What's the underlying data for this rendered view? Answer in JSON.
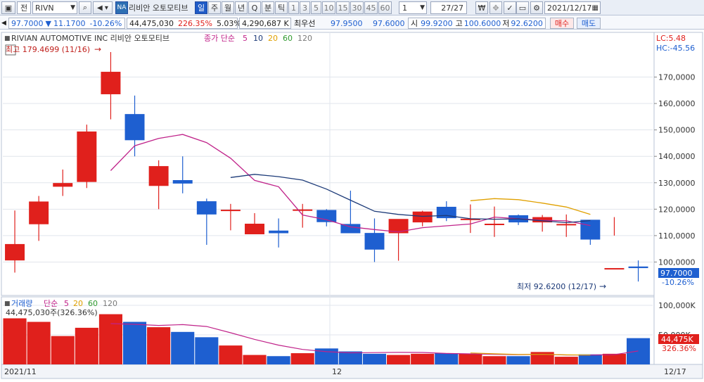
{
  "toolbar": {
    "market_label": "전",
    "symbol": "RIVN",
    "na_badge": "NA",
    "stock_name": "리비안 오토모티브",
    "period_buttons": [
      "일",
      "주",
      "월",
      "년",
      "Q",
      "분",
      "틱"
    ],
    "active_period": "일",
    "interval_buttons": [
      "1",
      "3",
      "5",
      "10",
      "15",
      "30",
      "45",
      "60"
    ],
    "count_value": "1",
    "page_counter": "27/27",
    "date": "2021/12/17"
  },
  "quote": {
    "price": "97.7000",
    "change": "11.1700",
    "change_pct": "-10.26%",
    "volume": "44,475,030",
    "volume_ratio": "226.35%",
    "turnover_pct": "5.03%",
    "amount": "4,290,687 K",
    "best_label": "최우선",
    "bid": "97.9500",
    "ask": "97.6000",
    "open_label": "시",
    "open": "99.9200",
    "high_label": "고",
    "high": "100.6000",
    "low_label": "저",
    "low": "92.6200",
    "buy_label": "매수",
    "sell_label": "매도"
  },
  "price_panel": {
    "title": "RIVIAN AUTOMOTIVE INC  리비안 오토모티브",
    "indicator_label": "종가 단순",
    "ma_periods": [
      "5",
      "10",
      "20",
      "60",
      "120"
    ],
    "high_annotation": "최고 179.4699 (11/16)",
    "low_annotation": "최저 92.6200 (12/17)",
    "lc_label": "LC:5.48",
    "hc_label": "HC:-45.56",
    "last_price_tag": "97.7000",
    "last_pct_tag": "-10.26%"
  },
  "volume_panel": {
    "title": "거래량",
    "indicator_label": "단순",
    "ma_periods": [
      "5",
      "20",
      "60",
      "120"
    ],
    "current_label": "44,475,030주(326.36%)",
    "last_tag": "44,475K",
    "last_pct_tag": "326.36%"
  },
  "x_labels": [
    "2021/11",
    "12",
    "12/17"
  ],
  "colors": {
    "up": "#e0201c",
    "down": "#1e5fd0",
    "ma5": "#c0238a",
    "ma10": "#1c3a78",
    "ma20": "#e0a000",
    "ma60": "#2f9a2f",
    "ma120": "#7a7a7a"
  },
  "chart_data": {
    "type": "candlestick",
    "x": [
      "11/10",
      "11/11",
      "11/12",
      "11/15",
      "11/16",
      "11/17",
      "11/18",
      "11/19",
      "11/22",
      "11/23",
      "11/24",
      "11/26",
      "11/29",
      "11/30",
      "12/01",
      "12/02",
      "12/03",
      "12/06",
      "12/07",
      "12/08",
      "12/09",
      "12/10",
      "12/13",
      "12/14",
      "12/15",
      "12/16",
      "12/17"
    ],
    "open": [
      100.6,
      114.3,
      128.5,
      130.3,
      163.5,
      156.0,
      128.8,
      131.0,
      123.0,
      119.6,
      110.5,
      111.9,
      119.6,
      119.7,
      114.4,
      111.0,
      110.9,
      115.0,
      120.9,
      116.4,
      114.5,
      117.7,
      115.0,
      114.4,
      116.0,
      97.7,
      98.3
    ],
    "close": [
      106.8,
      122.9,
      129.9,
      149.4,
      172.0,
      146.1,
      136.3,
      129.7,
      118.0,
      119.8,
      114.5,
      110.9,
      119.9,
      115.1,
      110.9,
      104.7,
      116.3,
      119.1,
      116.6,
      116.4,
      114.5,
      115.0,
      117.0,
      114.4,
      108.5,
      97.7,
      97.7
    ],
    "high": [
      119.5,
      125.0,
      135.0,
      152.0,
      179.4699,
      163.0,
      138.5,
      140.0,
      124.0,
      122.0,
      118.5,
      116.5,
      122.0,
      120.0,
      127.0,
      116.5,
      111.7,
      119.4,
      123.0,
      121.8,
      121.0,
      118.0,
      117.8,
      118.0,
      115.5,
      117.0,
      100.6
    ],
    "low": [
      96.0,
      108.0,
      125.0,
      128.0,
      154.0,
      140.0,
      120.0,
      126.0,
      106.5,
      112.0,
      112.0,
      105.5,
      113.0,
      113.5,
      111.0,
      100.0,
      100.5,
      113.5,
      115.5,
      111.0,
      109.5,
      114.0,
      111.5,
      109.5,
      106.5,
      110.0,
      92.62
    ],
    "ma5": [
      null,
      null,
      null,
      null,
      134.6,
      144.0,
      146.8,
      148.3,
      145.2,
      139.3,
      130.9,
      128.5,
      117.8,
      116.0,
      113.3,
      112.3,
      111.4,
      113.0,
      113.7,
      114.4,
      117.0,
      116.4,
      115.8,
      115.6,
      113.8,
      null,
      114.0
    ],
    "ma10": [
      null,
      null,
      null,
      null,
      null,
      null,
      null,
      null,
      null,
      132.0,
      133.2,
      132.3,
      131.0,
      127.6,
      123.4,
      119.2,
      118.0,
      117.3,
      117.6,
      116.4,
      116.2,
      116.3,
      115.6,
      114.9,
      115.7,
      null,
      114.4
    ],
    "ma20": [
      null,
      null,
      null,
      null,
      null,
      null,
      null,
      null,
      null,
      null,
      null,
      null,
      null,
      null,
      null,
      null,
      null,
      null,
      null,
      123.2,
      124.0,
      123.6,
      122.3,
      120.8,
      118.0,
      null,
      115.6
    ],
    "volume": [
      78.0,
      72.0,
      48.0,
      62.0,
      85.0,
      72.0,
      63.0,
      55.0,
      46.0,
      32.0,
      16.0,
      14.0,
      19.0,
      27.0,
      22.0,
      18.0,
      16.0,
      18.0,
      19.0,
      18.0,
      14.0,
      14.0,
      21.0,
      13.0,
      17.0,
      18.0,
      44.475
    ],
    "vol_ma5": [
      null,
      null,
      null,
      null,
      null,
      null,
      null,
      null,
      null,
      null,
      null,
      null,
      null,
      null,
      null,
      null,
      null,
      null,
      null,
      19.4,
      18.0,
      16.8,
      17.0,
      16.2,
      15.8,
      null,
      20.6
    ],
    "vol_ma20": [
      null,
      null,
      null,
      null,
      null,
      null,
      null,
      null,
      null,
      null,
      null,
      null,
      null,
      null,
      null,
      null,
      null,
      null,
      null,
      null,
      null,
      null,
      null,
      null,
      null,
      null,
      null
    ],
    "ylim": [
      90,
      180
    ],
    "y_ticks": [
      "170,0000",
      "160,0000",
      "150,0000",
      "140,0000",
      "130,0000",
      "120,0000",
      "110,0000",
      "100,0000"
    ],
    "vol_ylim": [
      0,
      100
    ],
    "vol_ticks": [
      "100,000K",
      "50,000K"
    ]
  }
}
